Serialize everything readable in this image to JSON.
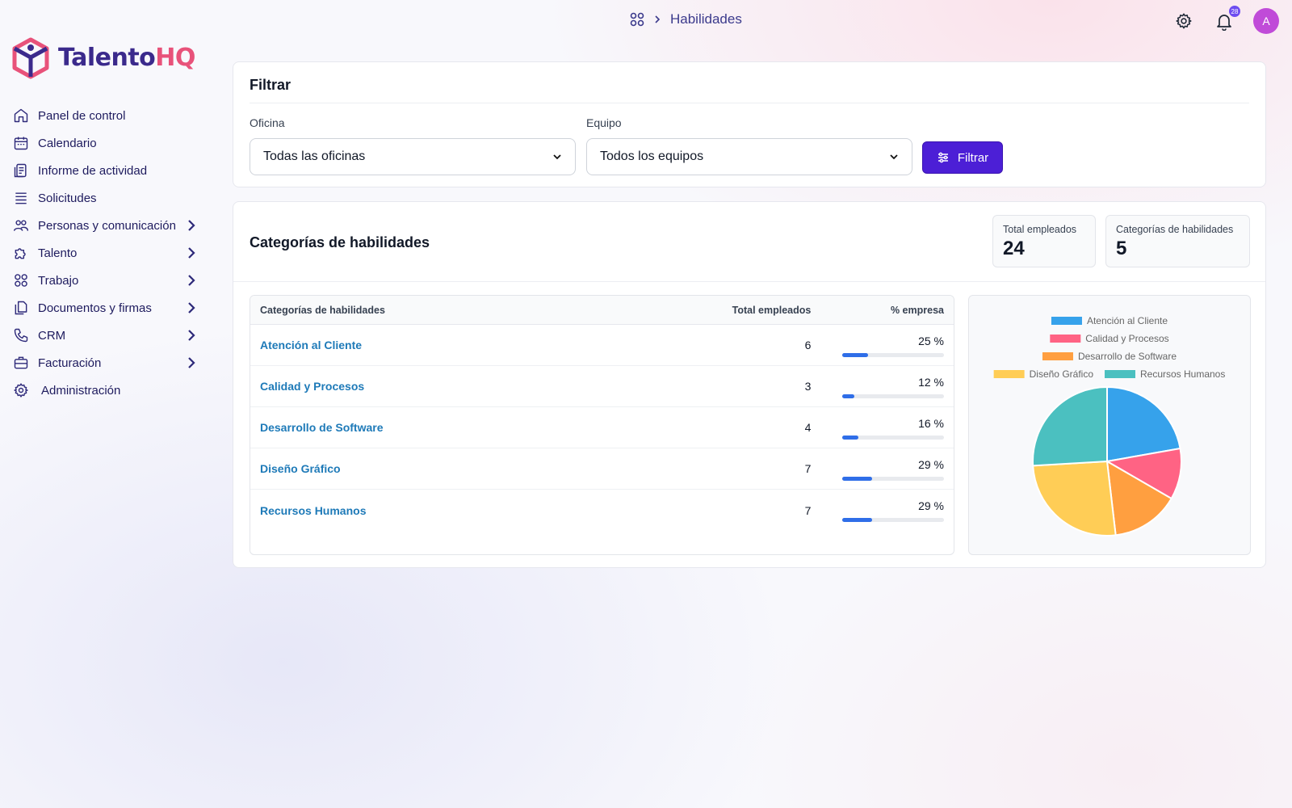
{
  "brand": {
    "name_part1": "Talento",
    "name_part2": "HQ"
  },
  "breadcrumb": {
    "current": "Habilidades"
  },
  "header": {
    "notification_count": "28",
    "avatar_initial": "A"
  },
  "sidebar": {
    "items": [
      {
        "label": "Panel de control",
        "icon": "home-icon",
        "has_children": false
      },
      {
        "label": "Calendario",
        "icon": "calendar-icon",
        "has_children": false
      },
      {
        "label": "Informe de actividad",
        "icon": "report-icon",
        "has_children": false
      },
      {
        "label": "Solicitudes",
        "icon": "list-icon",
        "has_children": false
      },
      {
        "label": "Personas y comunicación",
        "icon": "people-icon",
        "has_children": true
      },
      {
        "label": "Talento",
        "icon": "puzzle-icon",
        "has_children": true
      },
      {
        "label": "Trabajo",
        "icon": "grid-icon",
        "has_children": true
      },
      {
        "label": "Documentos y firmas",
        "icon": "documents-icon",
        "has_children": true
      },
      {
        "label": "CRM",
        "icon": "phone-icon",
        "has_children": true
      },
      {
        "label": "Facturación",
        "icon": "briefcase-icon",
        "has_children": true
      },
      {
        "label": "Administración",
        "icon": "gear-icon",
        "has_children": false
      }
    ]
  },
  "filter": {
    "title": "Filtrar",
    "office_label": "Oficina",
    "office_value": "Todas las oficinas",
    "team_label": "Equipo",
    "team_value": "Todos los equipos",
    "button_label": "Filtrar"
  },
  "skills": {
    "title": "Categorías de habilidades",
    "stats": [
      {
        "label": "Total empleados",
        "value": "24"
      },
      {
        "label": "Categorías de habilidades",
        "value": "5"
      }
    ],
    "table": {
      "headers": [
        "Categorías de habilidades",
        "Total empleados",
        "% empresa"
      ],
      "rows": [
        {
          "name": "Atención al Cliente",
          "total": "6",
          "percent": "25 %",
          "fraction": 0.25
        },
        {
          "name": "Calidad y Procesos",
          "total": "3",
          "percent": "12 %",
          "fraction": 0.12
        },
        {
          "name": "Desarrollo de Software",
          "total": "4",
          "percent": "16 %",
          "fraction": 0.16
        },
        {
          "name": "Diseño Gráfico",
          "total": "7",
          "percent": "29 %",
          "fraction": 0.29
        },
        {
          "name": "Recursos Humanos",
          "total": "7",
          "percent": "29 %",
          "fraction": 0.29
        }
      ]
    }
  },
  "colors": {
    "accent": "#4c1fd6",
    "link": "#1e7ab8",
    "bar": "#2f6ee8"
  },
  "chart_data": {
    "type": "pie",
    "categories": [
      "Atención al Cliente",
      "Calidad y Procesos",
      "Desarrollo de Software",
      "Diseño Gráfico",
      "Recursos Humanos"
    ],
    "values": [
      6,
      3,
      4,
      7,
      7
    ],
    "colors": [
      "#36a2eb",
      "#ff6384",
      "#ff9f40",
      "#ffcd56",
      "#4bc0c0"
    ],
    "legend": "top"
  }
}
